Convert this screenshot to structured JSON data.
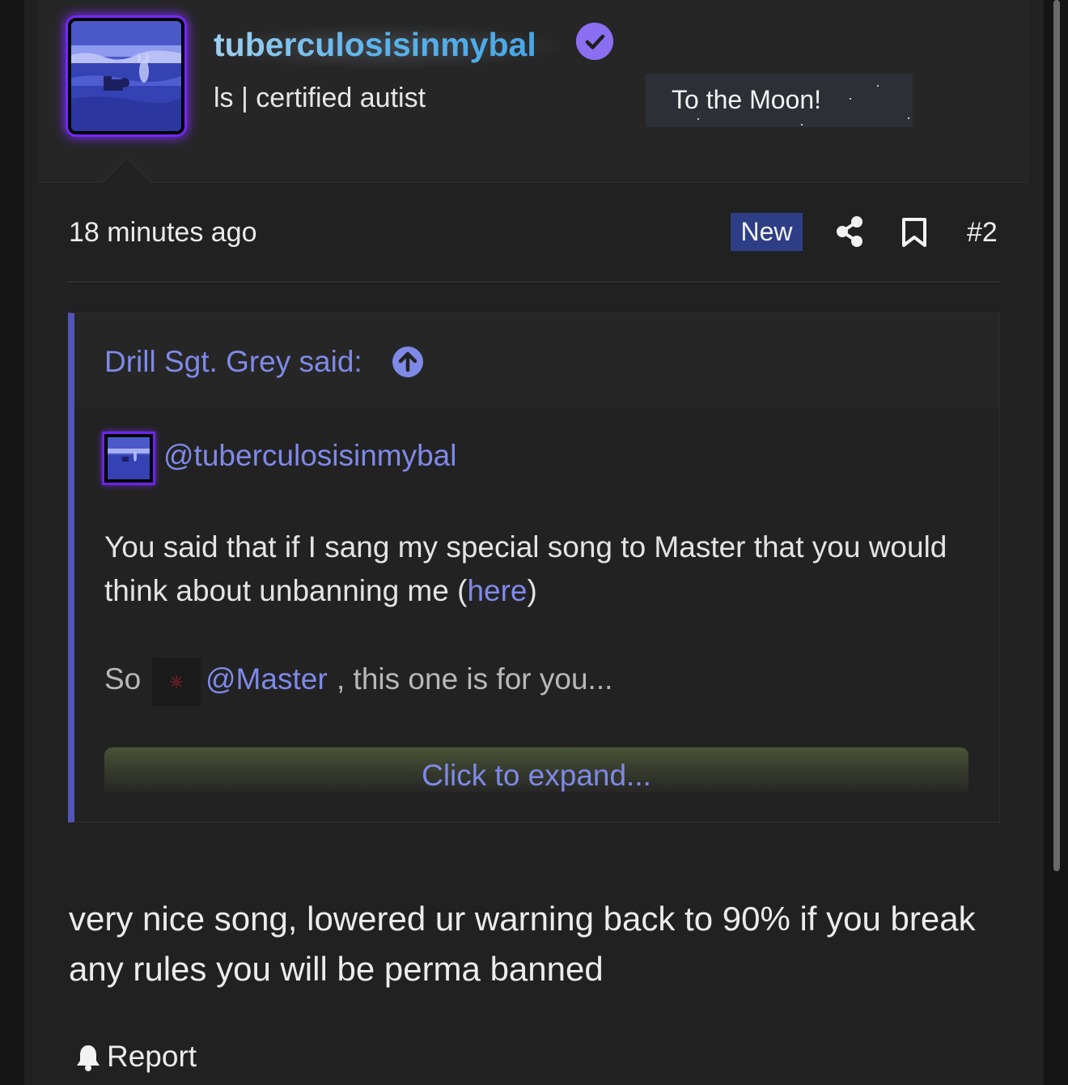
{
  "post": {
    "author": {
      "username": "tuberculosisinmybal",
      "title": "ls | certified autist",
      "banner": "To the Moon!",
      "verified": true
    },
    "timestamp": "18 minutes ago",
    "badge": "New",
    "post_number": "#2",
    "quote": {
      "attribution": "Drill Sgt. Grey said:",
      "mention": "@tuberculosisinmybal",
      "body_before_link": "You said that if I sang my special song to Master that you would think about unbanning me (",
      "link_text": "here",
      "body_after_link": ")",
      "so_prefix": "So",
      "master_mention": "@Master",
      "so_suffix": ", this one is for you...",
      "expand_label": "Click to expand..."
    },
    "reply": "very nice song, lowered ur warning back to 90% if you break any rules you will be perma banned",
    "report_label": "Report"
  },
  "colors": {
    "accent_link": "#7f89e8",
    "quote_bar": "#5355b8",
    "new_badge": "#2e3e86",
    "verified": "#8a6ff0",
    "avatar_glow": "#7b2cff"
  },
  "icons": {
    "verified": "check-circle-icon",
    "share": "share-icon",
    "bookmark": "bookmark-icon",
    "quote_jump": "arrow-up-circle-icon",
    "report": "bell-icon"
  }
}
